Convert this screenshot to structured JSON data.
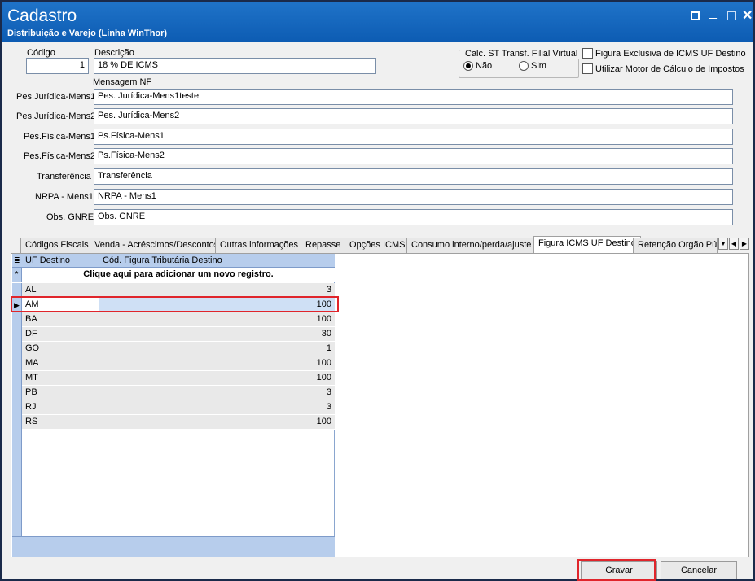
{
  "window": {
    "title": "Cadastro",
    "subtitle": "Distribuição e Varejo (Linha WinThor)"
  },
  "form": {
    "codigo_label": "Código",
    "codigo_value": "1",
    "descricao_label": "Descrição",
    "descricao_value": "18 % DE ICMS",
    "calc_st_label": "Calc. ST Transf. Filial Virtual",
    "radio_nao": "Não",
    "radio_sim": "Sim",
    "check_figura_exclusiva": "Figura Exclusiva de ICMS UF Destino",
    "check_motor_calculo": "Utilizar Motor de Cálculo de Impostos",
    "mensagem_nf_label": "Mensagem NF",
    "fields": [
      {
        "label": "Pes.Jurídica-Mens1",
        "value": "Pes. Jurídica-Mens1teste"
      },
      {
        "label": "Pes.Jurídica-Mens2",
        "value": "Pes. Jurídica-Mens2"
      },
      {
        "label": "Pes.Física-Mens1",
        "value": "Ps.Física-Mens1"
      },
      {
        "label": "Pes.Física-Mens2",
        "value": "Ps.Física-Mens2"
      },
      {
        "label": "Transferência",
        "value": "Transferência"
      },
      {
        "label": "NRPA - Mens1",
        "value": "NRPA - Mens1"
      },
      {
        "label": "Obs. GNRE",
        "value": "Obs. GNRE"
      }
    ]
  },
  "tabs": [
    "Códigos Fiscais",
    "Venda - Acréscimos/Descontos",
    "Outras informações",
    "Repasse",
    "Opções ICMS",
    "Consumo interno/perda/ajuste",
    "Figura ICMS UF Destino",
    "Retenção Orgão Públ"
  ],
  "grid": {
    "col_uf": "UF Destino",
    "col_cod": "Cód. Figura Tributária Destino",
    "add_row_text": "Clique aqui para adicionar um novo registro.",
    "rows": [
      {
        "uf": "AL",
        "cod": "3"
      },
      {
        "uf": "AM",
        "cod": "100"
      },
      {
        "uf": "BA",
        "cod": "100"
      },
      {
        "uf": "DF",
        "cod": "30"
      },
      {
        "uf": "GO",
        "cod": "1"
      },
      {
        "uf": "MA",
        "cod": "100"
      },
      {
        "uf": "MT",
        "cod": "100"
      },
      {
        "uf": "PB",
        "cod": "3"
      },
      {
        "uf": "RJ",
        "cod": "3"
      },
      {
        "uf": "RS",
        "cod": "100"
      }
    ]
  },
  "buttons": {
    "gravar": "Gravar",
    "cancelar": "Cancelar"
  }
}
